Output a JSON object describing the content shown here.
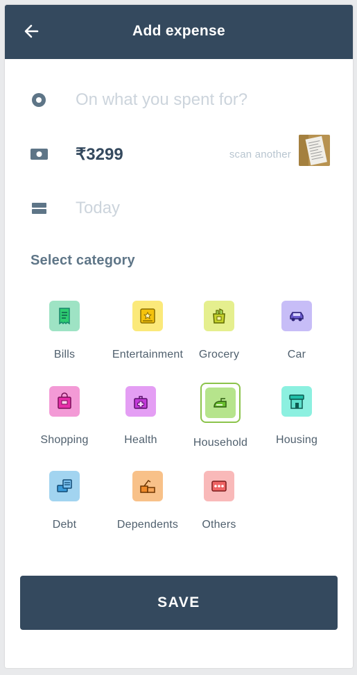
{
  "header": {
    "title": "Add expense",
    "back_icon": "arrow-left-icon"
  },
  "form": {
    "description_placeholder": "On what you spent for?",
    "amount": "₹3299",
    "scan_label": "scan another",
    "date_placeholder": "Today"
  },
  "category_section": {
    "title": "Select category"
  },
  "categories": [
    {
      "label": "Bills",
      "color": "#9ee3c4",
      "icon": "bill-icon"
    },
    {
      "label": "Entertainment",
      "color": "#fbe97a",
      "icon": "entertainment-icon"
    },
    {
      "label": "Grocery",
      "color": "#e5ef8e",
      "icon": "grocery-bag-icon"
    },
    {
      "label": "Car",
      "color": "#c7bdf7",
      "icon": "car-icon"
    },
    {
      "label": "Shopping",
      "color": "#f39ad6",
      "icon": "shopping-bag-icon"
    },
    {
      "label": "Health",
      "color": "#e49ef4",
      "icon": "medical-kit-icon"
    },
    {
      "label": "Household",
      "color": "#b6e48c",
      "icon": "household-iron-icon",
      "selected": true
    },
    {
      "label": "Housing",
      "color": "#8cf0e0",
      "icon": "house-icon"
    },
    {
      "label": "Debt",
      "color": "#a2d4f0",
      "icon": "debt-icon"
    },
    {
      "label": "Dependents",
      "color": "#f8c189",
      "icon": "dependents-icon"
    },
    {
      "label": "Others",
      "color": "#f9b9b9",
      "icon": "others-icon"
    }
  ],
  "save_button": {
    "label": "SAVE"
  }
}
